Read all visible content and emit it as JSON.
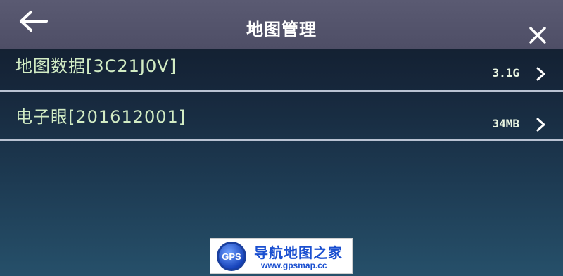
{
  "header": {
    "title": "地图管理",
    "back_icon": "arrow-left-icon",
    "close_icon": "close-icon"
  },
  "rows": [
    {
      "label": "地图数据[3C21J0V]",
      "value": "3.1G",
      "icon": "chevron-right-icon"
    },
    {
      "label": "电子眼[201612001]",
      "value": "34MB",
      "icon": "chevron-right-icon"
    }
  ],
  "watermark": {
    "logo_text": "GPS",
    "title": "导航地图之家",
    "url": "www.gpsmap.cc"
  },
  "colors": {
    "header_bg": "#55556c",
    "row_label": "#d2ecc4",
    "divider": "#b9c2d2",
    "watermark_blue": "#1a4fd0"
  }
}
